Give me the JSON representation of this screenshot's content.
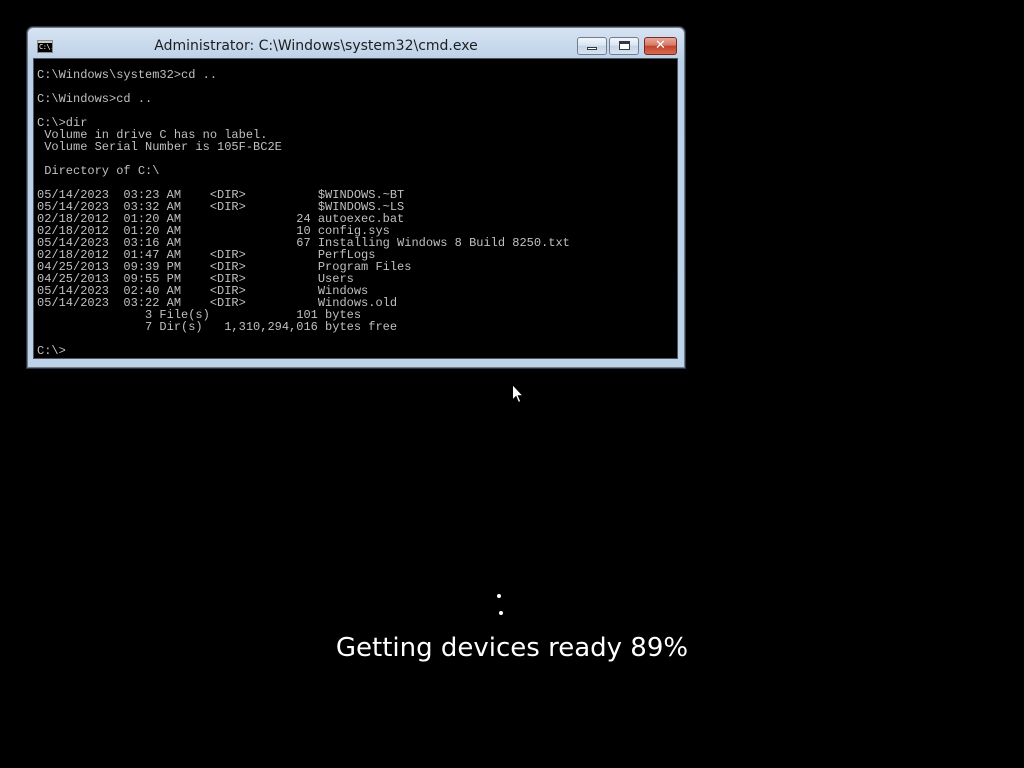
{
  "window": {
    "title": "Administrator: C:\\Windows\\system32\\cmd.exe",
    "icon_label": "C:\\.",
    "icon": "cmd-icon",
    "buttons": {
      "minimize_icon": "minimize-icon",
      "maximize_icon": "restore-icon",
      "close_glyph": "✕"
    }
  },
  "console": {
    "lines": [
      "C:\\Windows\\system32>cd ..",
      "",
      "C:\\Windows>cd ..",
      "",
      "C:\\>dir",
      " Volume in drive C has no label.",
      " Volume Serial Number is 105F-BC2E",
      "",
      " Directory of C:\\",
      "",
      "05/14/2023  03:23 AM    <DIR>          $WINDOWS.~BT",
      "05/14/2023  03:32 AM    <DIR>          $WINDOWS.~LS",
      "02/18/2012  01:20 AM                24 autoexec.bat",
      "02/18/2012  01:20 AM                10 config.sys",
      "05/14/2023  03:16 AM                67 Installing Windows 8 Build 8250.txt",
      "02/18/2012  01:47 AM    <DIR>          PerfLogs",
      "04/25/2013  09:39 PM    <DIR>          Program Files",
      "04/25/2013  09:55 PM    <DIR>          Users",
      "05/14/2023  02:40 AM    <DIR>          Windows",
      "05/14/2023  03:22 AM    <DIR>          Windows.old",
      "               3 File(s)            101 bytes",
      "               7 Dir(s)   1,310,294,016 bytes free",
      "",
      "C:\\>"
    ],
    "text_color": "#c0c0c0",
    "background": "#000000"
  },
  "setup": {
    "status": "Getting devices ready 89%",
    "progress_percent": 89,
    "spinner_icon": "loading-dots-icon"
  },
  "pointer": {
    "icon": "mouse-pointer-icon"
  }
}
